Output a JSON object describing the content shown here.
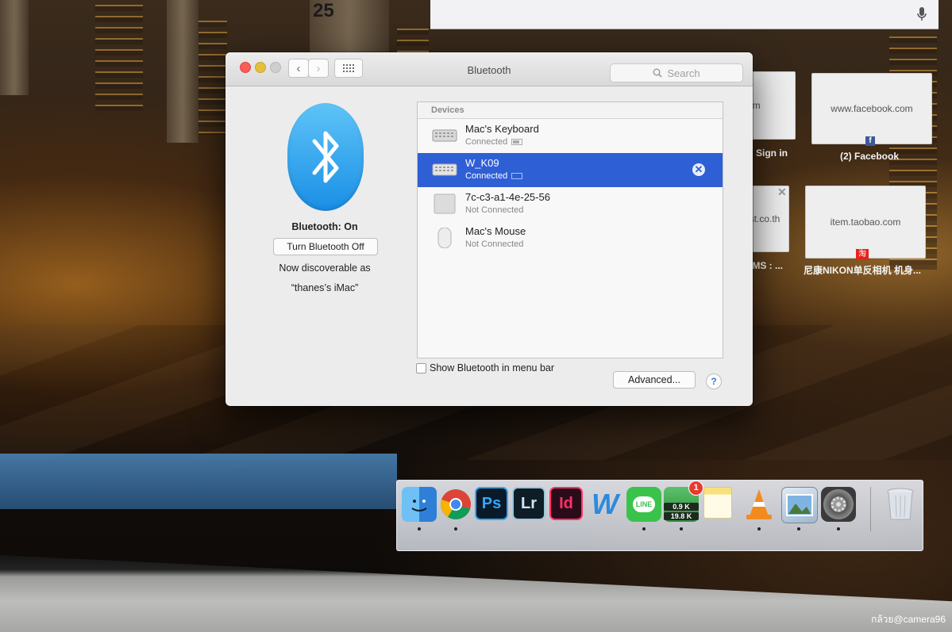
{
  "window": {
    "title": "Bluetooth",
    "search_placeholder": "Search"
  },
  "bluetooth": {
    "status": "Bluetooth: On",
    "toggle_label": "Turn Bluetooth Off",
    "discoverable_line1": "Now discoverable as",
    "discoverable_line2": "“thanes’s iMac”"
  },
  "devices": {
    "header": "Devices",
    "items": [
      {
        "name": "Mac's Keyboard",
        "status": "Connected",
        "icon": "keyboard-icon",
        "selected": false
      },
      {
        "name": "W_K09",
        "status": "Connected",
        "icon": "keyboard-icon",
        "selected": true
      },
      {
        "name": "7c-c3-a1-4e-25-56",
        "status": "Not Connected",
        "icon": "generic-device-icon",
        "selected": false
      },
      {
        "name": "Mac's Mouse",
        "status": "Not Connected",
        "icon": "mouse-icon",
        "selected": false
      }
    ]
  },
  "footer": {
    "menu_bar_checkbox_label": "Show Bluetooth in menu bar",
    "menu_bar_checked": false,
    "advanced_label": "Advanced...",
    "help_label": "?"
  },
  "background": {
    "digit": "25",
    "tiles": [
      {
        "text": "www.facebook.com",
        "caption": "(2) Facebook"
      },
      {
        "text": "item.taobao.com",
        "caption": "尼康NIKON单反相机 机身..."
      },
      {
        "text": "om",
        "caption": "y: Sign in"
      },
      {
        "text": "ost.co.th",
        "caption": ": EMS : ..."
      }
    ]
  },
  "dock": {
    "items": [
      "finder-icon",
      "chrome-icon",
      "photoshop-icon",
      "lightroom-icon",
      "indesign-icon",
      "word-icon",
      "line-icon",
      "network-monitor-icon",
      "notes-icon",
      "vlc-icon",
      "preview-icon",
      "system-preferences-icon",
      "trash-icon"
    ],
    "labels": {
      "ps": "Ps",
      "lr": "Lr",
      "id": "Id",
      "w": "W",
      "line": "LINE"
    },
    "badge": "1",
    "net_up": "0.9 K",
    "net_down": "19.8 K"
  },
  "watermark": "กล้วย@camera96",
  "colors": {
    "selection": "#2f5fd5",
    "bluetooth_blue": "#1a8fe6"
  }
}
